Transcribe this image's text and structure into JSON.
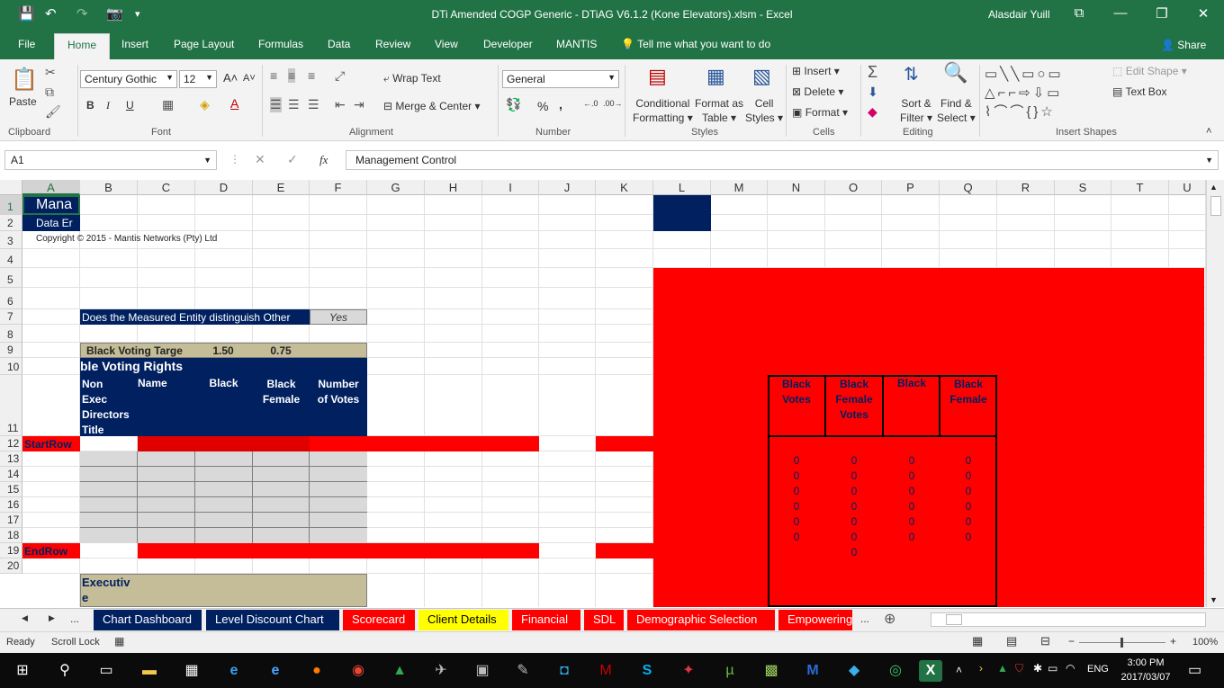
{
  "window": {
    "title": "DTi Amended COGP Generic - DTiAG V6.1.2 (Kone Elevators).xlsm  -  Excel",
    "user": "Alasdair Yuill"
  },
  "quick_access": {
    "save": "💾",
    "undo": "↶",
    "redo": "↷",
    "camera": "📷",
    "more": "▾"
  },
  "window_controls": {
    "ribbon_display": "⧉",
    "minimize": "—",
    "restore": "❐",
    "close": "✕"
  },
  "tabs": [
    "File",
    "Home",
    "Insert",
    "Page Layout",
    "Formulas",
    "Data",
    "Review",
    "View",
    "Developer",
    "MANTIS"
  ],
  "active_tab": "Home",
  "tell_me": "Tell me what you want to do",
  "share_label": "Share",
  "ribbon": {
    "groups": {
      "clipboard": "Clipboard",
      "font": "Font",
      "alignment": "Alignment",
      "number": "Number",
      "styles": "Styles",
      "cells": "Cells",
      "editing": "Editing",
      "insert_shapes": "Insert Shapes"
    },
    "paste": "Paste",
    "font_name": "Century Gothic",
    "font_size": "12",
    "bold": "B",
    "italic": "I",
    "underline": "U",
    "wrap_text": "Wrap Text",
    "merge_center": "Merge & Center",
    "number_format": "General",
    "percent": "%",
    "comma": ",",
    "cond_formatting": [
      "Conditional",
      "Formatting"
    ],
    "format_as_table": [
      "Format as",
      "Table"
    ],
    "cell_styles": [
      "Cell",
      "Styles"
    ],
    "insert": "Insert",
    "delete": "Delete",
    "format": "Format",
    "sort_filter": [
      "Sort &",
      "Filter"
    ],
    "find_select": [
      "Find &",
      "Select"
    ],
    "edit_shape": "Edit Shape",
    "text_box": "Text Box"
  },
  "formula_bar": {
    "name_box": "A1",
    "content": "Management Control",
    "fx": "fx"
  },
  "columns": [
    "A",
    "B",
    "C",
    "D",
    "E",
    "F",
    "G",
    "H",
    "I",
    "J",
    "K",
    "L",
    "M",
    "N",
    "O",
    "P",
    "Q",
    "R",
    "S",
    "T",
    "U"
  ],
  "rows": [
    "1",
    "2",
    "3",
    "4",
    "5",
    "6",
    "7",
    "8",
    "9",
    "10",
    "11",
    "12",
    "13",
    "14",
    "15",
    "16",
    "17",
    "18",
    "19",
    "20"
  ],
  "cells": {
    "a1": "Mana",
    "a2": "Data Er",
    "a3": "Copyright © 2015 - Mantis Networks (Pty) Ltd",
    "b7": "Does the Measured Entity distinguish Other",
    "f7": "Yes",
    "b9": "Black Voting Targe",
    "d9": "1.50",
    "e9": "0.75",
    "b10": "ble Voting Rights",
    "b11": [
      "Non",
      "Exec",
      "Directors",
      "Title"
    ],
    "c11": "Name",
    "d11": "Black",
    "e11": [
      "Black",
      "Female"
    ],
    "f11": [
      "Number",
      "of Votes"
    ],
    "a12": "StartRow",
    "a19": "EndRow",
    "b20": [
      "Executiv",
      "e"
    ],
    "n_header": [
      "Black",
      "Votes"
    ],
    "o_header": [
      "Black",
      "Female",
      "Votes"
    ],
    "p_header": [
      "Black"
    ],
    "q_header": [
      "Black",
      "Female"
    ],
    "n_values": [
      "0",
      "0",
      "0",
      "0",
      "0",
      "0"
    ],
    "o_values": [
      "0",
      "0",
      "0",
      "0",
      "0",
      "0",
      "0"
    ],
    "p_values": [
      "0",
      "0",
      "0",
      "0",
      "0",
      "0"
    ],
    "q_values": [
      "0",
      "0",
      "0",
      "0",
      "0",
      "0"
    ]
  },
  "sheet_tabs": [
    {
      "label": "Chart Dashboard",
      "bg": "#002060",
      "fg": "#ffffff"
    },
    {
      "label": "Level Discount Chart",
      "bg": "#002060",
      "fg": "#ffffff"
    },
    {
      "label": "Scorecard",
      "bg": "#ff0000",
      "fg": "#ffffff"
    },
    {
      "label": "Client Details",
      "bg": "#ffff00",
      "fg": "#000000"
    },
    {
      "label": "Financial",
      "bg": "#ff0000",
      "fg": "#ffffff"
    },
    {
      "label": "SDL",
      "bg": "#ff0000",
      "fg": "#ffffff"
    },
    {
      "label": "Demographic Selection",
      "bg": "#ff0000",
      "fg": "#ffffff"
    },
    {
      "label": "Empowering",
      "bg": "#ff0000",
      "fg": "#ffffff"
    }
  ],
  "sheet_nav": {
    "prev": "◀",
    "next": "▶",
    "more_left": "...",
    "more_right": "...",
    "add": "⊕"
  },
  "status": {
    "ready": "Ready",
    "scroll_lock": "Scroll Lock",
    "zoom": "100%",
    "zoom_out": "−",
    "zoom_in": "+"
  },
  "taskbar": {
    "time": "3:00 PM",
    "date": "2017/03/07",
    "lang": "ENG"
  },
  "colors": {
    "excel_green": "#217346",
    "navy": "#002060",
    "red": "#ff0000",
    "tan": "#c4bd97",
    "grey_cell": "#d9d9d9"
  }
}
